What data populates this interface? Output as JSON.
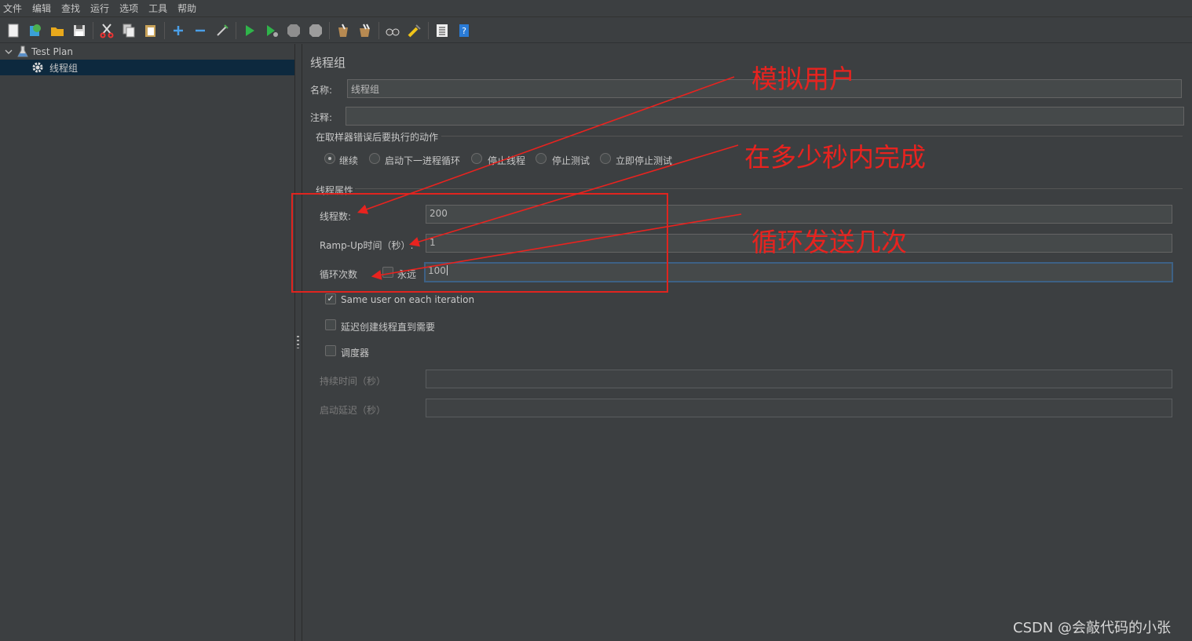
{
  "menubar": {
    "items": [
      "文件",
      "编辑",
      "查找",
      "运行",
      "选项",
      "工具",
      "帮助"
    ]
  },
  "toolbar": {
    "icons": [
      "new-icon",
      "templates-icon",
      "open-icon",
      "save-icon",
      "cut-icon",
      "copy-icon",
      "paste-icon",
      "expand-icon",
      "collapse-icon",
      "toggle-icon",
      "start-icon",
      "start-no-pause-icon",
      "stop-icon",
      "shutdown-icon",
      "clear-icon",
      "clear-all-icon",
      "search-icon",
      "reset-search-icon",
      "function-helper-icon",
      "help-icon"
    ]
  },
  "tree": {
    "root": "Test Plan",
    "child": "线程组"
  },
  "panel": {
    "title": "线程组",
    "name_label": "名称:",
    "name_value": "线程组",
    "comment_label": "注释:",
    "comment_value": "",
    "error_group_label": "在取样器错误后要执行的动作",
    "error_options": [
      "继续",
      "启动下一进程循环",
      "停止线程",
      "停止测试",
      "立即停止测试"
    ],
    "error_selected": "继续",
    "thread_props_label": "线程属性",
    "threads_label": "线程数:",
    "threads_value": "200",
    "rampup_label": "Ramp-Up时间（秒）:",
    "rampup_value": "1",
    "loop_label": "循环次数",
    "forever_label": "永远",
    "loop_value": "100",
    "same_user_label": "Same user on each iteration",
    "same_user_checked": true,
    "delay_create_label": "延迟创建线程直到需要",
    "scheduler_label": "调度器",
    "duration_label": "持续时间（秒）",
    "startup_delay_label": "启动延迟（秒）"
  },
  "annotations": {
    "simulate_users": "模拟用户",
    "within_seconds": "在多少秒内完成",
    "loop_times": "循环发送几次",
    "color": "#e8231f"
  },
  "watermark": "CSDN @会敲代码的小张"
}
